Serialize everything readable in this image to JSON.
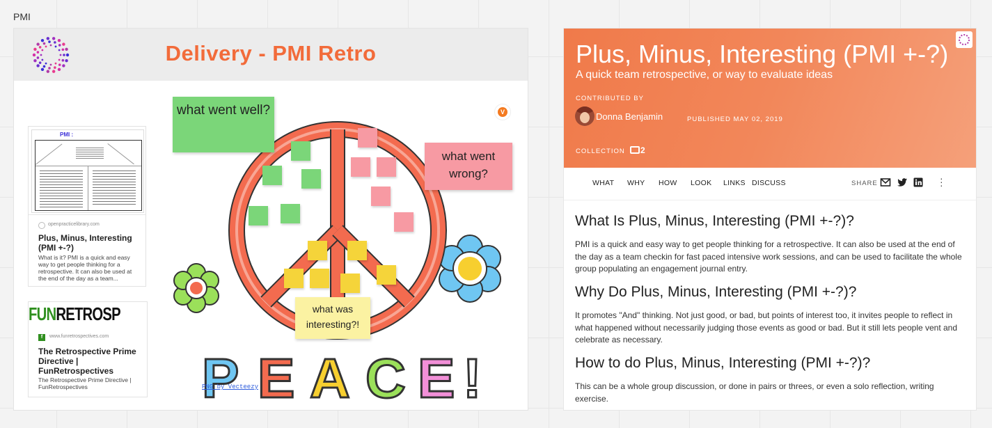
{
  "frame": {
    "label": "PMI"
  },
  "board": {
    "title": "Delivery - PMI Retro",
    "card1": {
      "thumb_title": "PMI :",
      "site": "openpracticelibrary.com",
      "title": "Plus, Minus, Interesting (PMI +-?)",
      "desc": "What is it? PMI is a quick and easy way to get people thinking for a retrospective. It can also be used at the end of the day as a team..."
    },
    "card2": {
      "logo_a": "FUN",
      "logo_b": "RETROSPECTIVES",
      "site": "www.funretrospectives.com",
      "title": "The Retrospective Prime Directive | FunRetrospectives",
      "desc": "The Retrospective Prime Directive | FunRetrospectives"
    },
    "notes": {
      "well": "what went well?",
      "wrong": "what went wrong?",
      "interesting": "what was interesting?!"
    },
    "peace_text": "PEACE!",
    "png_credit": "PNG by Vecteezy",
    "colors": {
      "title": "#f26b3a",
      "green": "#7bd679",
      "pink": "#f79aa3",
      "yellow": "#f5d43a"
    }
  },
  "panel": {
    "title": "Plus, Minus, Interesting (PMI +-?)",
    "subtitle": "A quick team retrospective, or way to evaluate ideas",
    "contributed_by": "CONTRIBUTED BY",
    "author": "Donna Benjamin",
    "published": "PUBLISHED MAY 02, 2019",
    "collection": "COLLECTION",
    "collection_count": "2",
    "nav": [
      "WHAT",
      "WHY",
      "HOW",
      "LOOK",
      "LINKS",
      "DISCUSS"
    ],
    "share": "SHARE",
    "sections": [
      {
        "heading": "What Is Plus, Minus, Interesting (PMI +-?)?",
        "body": "PMI is a quick and easy way to get people thinking for a retrospective. It can also be used at the end of the day as a team checkin for fast paced intensive work sessions, and can be used to facilitate the whole group populating an engagement journal entry."
      },
      {
        "heading": "Why Do Plus, Minus, Interesting (PMI +-?)?",
        "body": "It promotes \"And\" thinking. Not just good, or bad, but points of interest too, it invites people to reflect in what happened without necessarily judging those events as good or bad. But it still lets people vent and celebrate as necessary."
      },
      {
        "heading": "How to do Plus, Minus, Interesting (PMI +-?)?",
        "body": "This can be a whole group discussion, or done in pairs or threes, or even a solo reflection, writing exercise."
      }
    ],
    "colors": {
      "hero_start": "#f07a4a",
      "hero_end": "#f5a07a"
    }
  }
}
